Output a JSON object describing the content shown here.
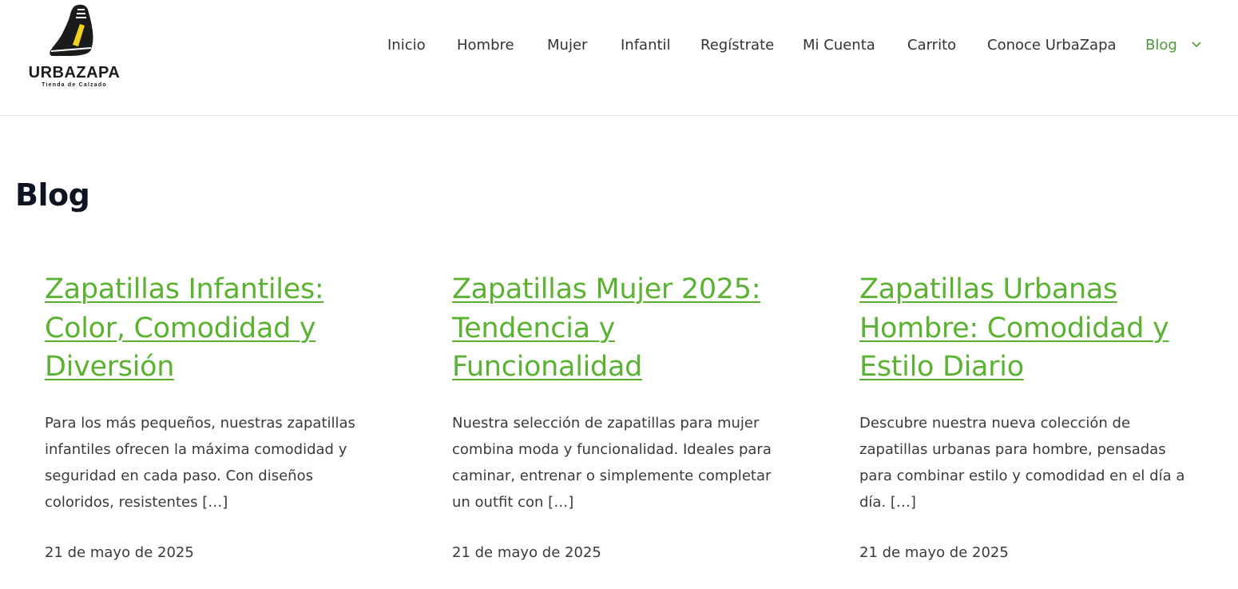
{
  "logo": {
    "name": "URBAZAPA",
    "tagline": "Tienda de Calzado",
    "icon": "sneaker-icon"
  },
  "nav": {
    "items": [
      {
        "label": "Inicio"
      },
      {
        "label": "Hombre"
      },
      {
        "label": "Mujer"
      },
      {
        "label": "Infantil"
      },
      {
        "label": "Regístrate"
      },
      {
        "label": "Mi Cuenta"
      },
      {
        "label": "Carrito"
      },
      {
        "label": "Conoce UrbaZapa"
      },
      {
        "label": "Blog",
        "active": true,
        "icon": "chevron-down-icon"
      }
    ]
  },
  "page": {
    "title": "Blog"
  },
  "posts": [
    {
      "title": "Zapatillas Infantiles: Color, Comodidad y Diversión",
      "excerpt": "Para los más pequeños, nuestras zapatillas infantiles ofrecen la máxima comodidad y seguridad en cada paso. Con diseños coloridos, resistentes […]",
      "date": "21 de mayo de 2025"
    },
    {
      "title": "Zapatillas Mujer 2025: Tendencia y Funcionalidad",
      "excerpt": "Nuestra selección de zapatillas para mujer combina moda y funcionalidad. Ideales para caminar, entrenar o simplemente completar un outfit con […]",
      "date": "21 de mayo de 2025"
    },
    {
      "title": "Zapatillas Urbanas Hombre: Comodidad y Estilo Diario",
      "excerpt": "Descubre nuestra nueva colección de zapatillas urbanas para hombre, pensadas para combinar estilo y comodidad en el día a día. […]",
      "date": "21 de mayo de 2025"
    }
  ],
  "colors": {
    "link_green": "#5bb232",
    "active_nav": "#4d9a3a",
    "title_dark": "#0d1421",
    "text": "#3a3a3a",
    "logo_accent": "#f2d21b"
  }
}
